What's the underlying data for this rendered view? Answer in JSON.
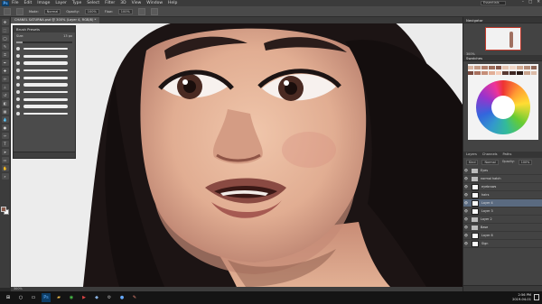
{
  "app": {
    "logo": "Ps",
    "menu": [
      "File",
      "Edit",
      "Image",
      "Layer",
      "Type",
      "Select",
      "Filter",
      "3D",
      "View",
      "Window",
      "Help"
    ],
    "workspace": "Essentials",
    "window_controls": [
      "–",
      "□",
      "✕"
    ]
  },
  "options_bar": {
    "mode_label": "Mode:",
    "mode_value": "Normal",
    "opacity_label": "Opacity:",
    "opacity_value": "100%",
    "flow_label": "Flow:",
    "flow_value": "100%"
  },
  "document": {
    "tab_title": "CHANEL SATURNA.psd @ 300% (Layer 4, RGB/8) *",
    "status": "300%"
  },
  "brush_panel": {
    "title": "Brush Presets",
    "size_label": "Size:",
    "size_value": "13 px",
    "slider_fill": 0.12,
    "strokes": 10
  },
  "navigator": {
    "title": "Navigator",
    "zoom": "300%"
  },
  "swatches": {
    "title": "Swatches"
  },
  "layers": {
    "tabs": [
      "Layers",
      "Channels",
      "Paths"
    ],
    "kind_label": "Kind",
    "blend_mode": "Normal",
    "opacity_label": "Opacity:",
    "opacity_value": "100%",
    "items": [
      {
        "name": "Eyes",
        "type": "folder",
        "active": false
      },
      {
        "name": "normal hatch",
        "type": "folder",
        "active": false
      },
      {
        "name": "eyebrows",
        "type": "layer",
        "active": false
      },
      {
        "name": "hairs",
        "type": "layer",
        "active": false
      },
      {
        "name": "Layer 4",
        "type": "layer",
        "active": true
      },
      {
        "name": "Layer 3",
        "type": "layer",
        "active": false
      },
      {
        "name": "Layer 2",
        "type": "folder",
        "active": false
      },
      {
        "name": "Base",
        "type": "folder",
        "active": false
      },
      {
        "name": "Layer 8",
        "type": "layer",
        "active": false
      },
      {
        "name": "Sign",
        "type": "layer",
        "active": false
      }
    ]
  },
  "taskbar": {
    "time": "2:56 PM",
    "date": "2019-04-01"
  },
  "colors": {
    "skin_light": "#e8b89c",
    "skin_shadow": "#b5796a",
    "hair": "#1c1414",
    "lips": "#8a4a42"
  }
}
